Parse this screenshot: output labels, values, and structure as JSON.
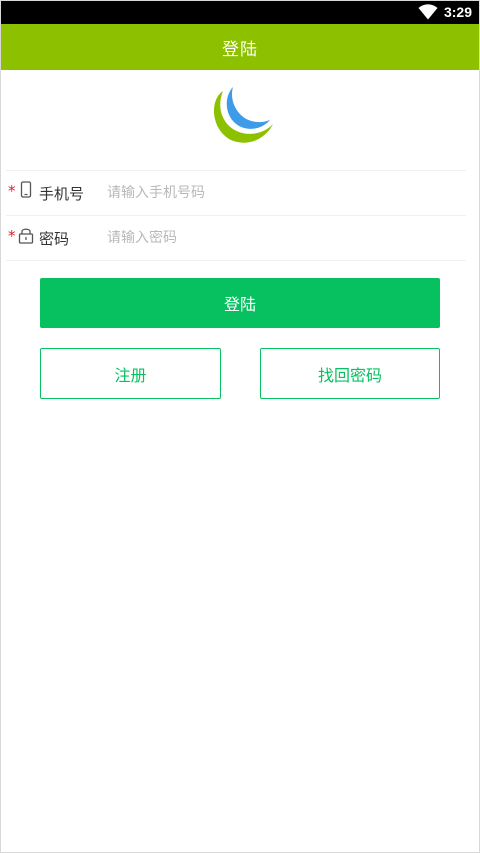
{
  "status_bar": {
    "time": "3:29",
    "icons": [
      "wifi-icon"
    ]
  },
  "app_bar": {
    "title": "登陆",
    "background_color": "#8dc100"
  },
  "logo": {
    "icon": "app-logo-crescent-icon",
    "colors": [
      "#8dc100",
      "#3d9be9"
    ]
  },
  "form": {
    "phone": {
      "required_mark": "*",
      "icon": "phone-icon",
      "label": "手机号",
      "placeholder": "请输入手机号码",
      "value": ""
    },
    "password": {
      "required_mark": "*",
      "icon": "lock-icon",
      "label": "密码",
      "placeholder": "请输入密码",
      "value": ""
    }
  },
  "buttons": {
    "login_label": "登陆",
    "register_label": "注册",
    "recover_label": "找回密码",
    "primary_color": "#07c160"
  }
}
